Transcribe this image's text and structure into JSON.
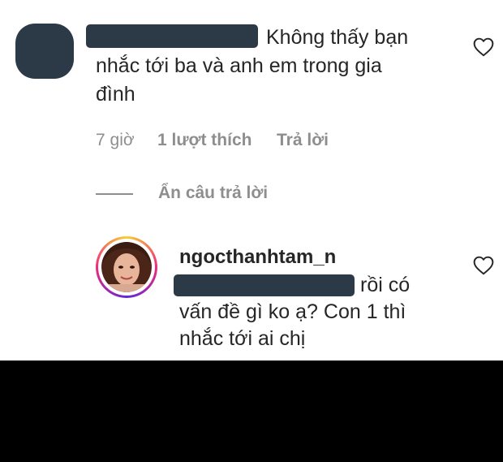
{
  "comment": {
    "text_line1": "Không thấy bạn",
    "text_line2": "nhắc tới ba và anh em trong gia",
    "text_line3": "đình",
    "time": "7 giờ",
    "likes": "1 lượt thích",
    "reply": "Trả lời",
    "hide_replies": "Ẩn câu trả lời",
    "like_icon": "heart-outline-icon"
  },
  "reply_comment": {
    "username": "ngocthanhtam_n",
    "text_line1": "rồi có",
    "text_line2": "vấn đề gì ko ạ? Con 1 thì",
    "text_line3": "nhắc tới ai chị",
    "like_icon": "heart-outline-icon",
    "avatar_ring_colors": [
      "#f9ce34",
      "#ee2a7b",
      "#6228d7"
    ]
  },
  "colors": {
    "redaction": "#2c3946",
    "text": "#262626",
    "muted": "#8e8e8e"
  }
}
